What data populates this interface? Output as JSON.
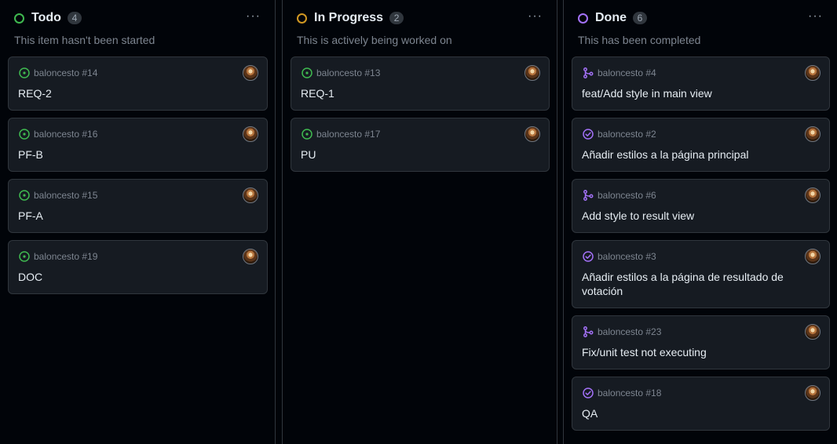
{
  "columns": [
    {
      "title": "Todo",
      "count": "4",
      "description": "This item hasn't been started",
      "status_color": "#3fb950",
      "cards": [
        {
          "repo": "baloncesto #14",
          "title": "REQ-2",
          "icon": "issue-open-icon"
        },
        {
          "repo": "baloncesto #16",
          "title": "PF-B",
          "icon": "issue-open-icon"
        },
        {
          "repo": "baloncesto #15",
          "title": "PF-A",
          "icon": "issue-open-icon"
        },
        {
          "repo": "baloncesto #19",
          "title": "DOC",
          "icon": "issue-open-icon"
        }
      ]
    },
    {
      "title": "In Progress",
      "count": "2",
      "description": "This is actively being worked on",
      "status_color": "#d29922",
      "cards": [
        {
          "repo": "baloncesto #13",
          "title": "REQ-1",
          "icon": "issue-open-icon"
        },
        {
          "repo": "baloncesto #17",
          "title": "PU",
          "icon": "issue-open-icon"
        }
      ]
    },
    {
      "title": "Done",
      "count": "6",
      "description": "This has been completed",
      "status_color": "#a371f7",
      "cards": [
        {
          "repo": "baloncesto #4",
          "title": "feat/Add style in main view",
          "icon": "pr-merged-icon"
        },
        {
          "repo": "baloncesto #2",
          "title": "Añadir estilos a la página principal",
          "icon": "issue-closed-icon"
        },
        {
          "repo": "baloncesto #6",
          "title": "Add style to result view",
          "icon": "pr-merged-icon"
        },
        {
          "repo": "baloncesto #3",
          "title": "Añadir estilos a la página de resultado de votación",
          "icon": "issue-closed-icon"
        },
        {
          "repo": "baloncesto #23",
          "title": "Fix/unit test not executing",
          "icon": "pr-merged-icon"
        },
        {
          "repo": "baloncesto #18",
          "title": "QA",
          "icon": "issue-closed-icon"
        }
      ]
    }
  ],
  "more_label": "···",
  "colors": {
    "open": "#3fb950",
    "done": "#a371f7",
    "background": "#010409",
    "card": "#161b22"
  }
}
